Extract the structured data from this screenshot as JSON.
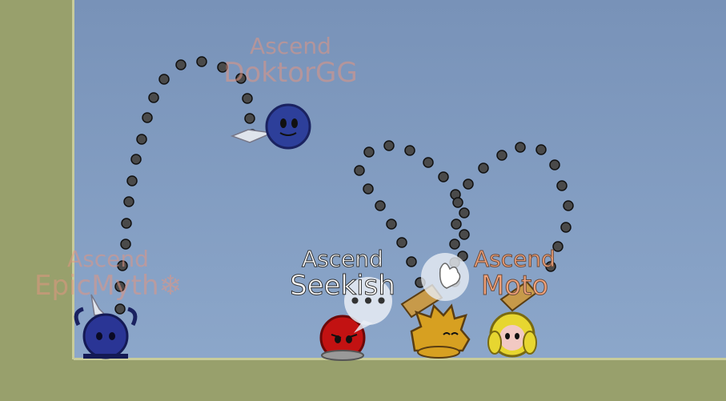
{
  "players": [
    {
      "clan": "Ascend",
      "name": "DoktorGG"
    },
    {
      "clan": "Ascend",
      "name": "EpicMyth❄"
    },
    {
      "clan": "Ascend",
      "name": "Seekish"
    },
    {
      "clan": "Ascend",
      "name": "Moto"
    }
  ],
  "emotes": {
    "chat": "•••"
  },
  "colors": {
    "sky": "#7892b8",
    "ground": "#98a06c",
    "hook_dot": "#4a4a4a"
  }
}
